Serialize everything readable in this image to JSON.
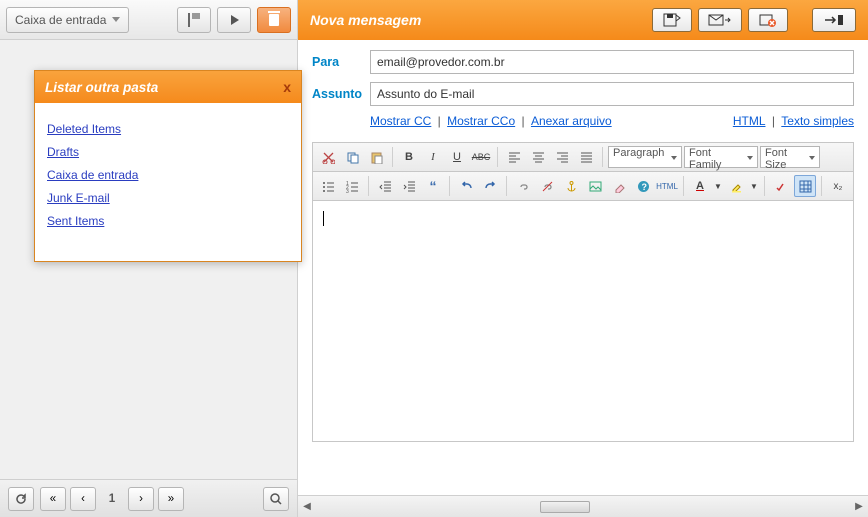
{
  "left": {
    "folder_dropdown_label": "Caixa de entrada",
    "popup": {
      "title": "Listar outra pasta",
      "items": [
        "Deleted Items",
        "Drafts",
        "Caixa de entrada",
        "Junk E-mail",
        "Sent Items"
      ]
    },
    "page_num": "1"
  },
  "compose": {
    "header_title": "Nova mensagem",
    "to_label": "Para",
    "subject_label": "Assunto",
    "to_value": "email@provedor.com.br",
    "subject_value": "Assunto do E-mail",
    "links": {
      "cc": "Mostrar CC",
      "bcc": "Mostrar CCo",
      "attach": "Anexar arquivo",
      "html": "HTML",
      "plain": "Texto simples",
      "sep": " | "
    },
    "format_select": "Paragraph",
    "font_family_select": "Font Family",
    "font_size_select": "Font Size",
    "html_btn_label": "HTML",
    "x2_label": "x₂"
  }
}
